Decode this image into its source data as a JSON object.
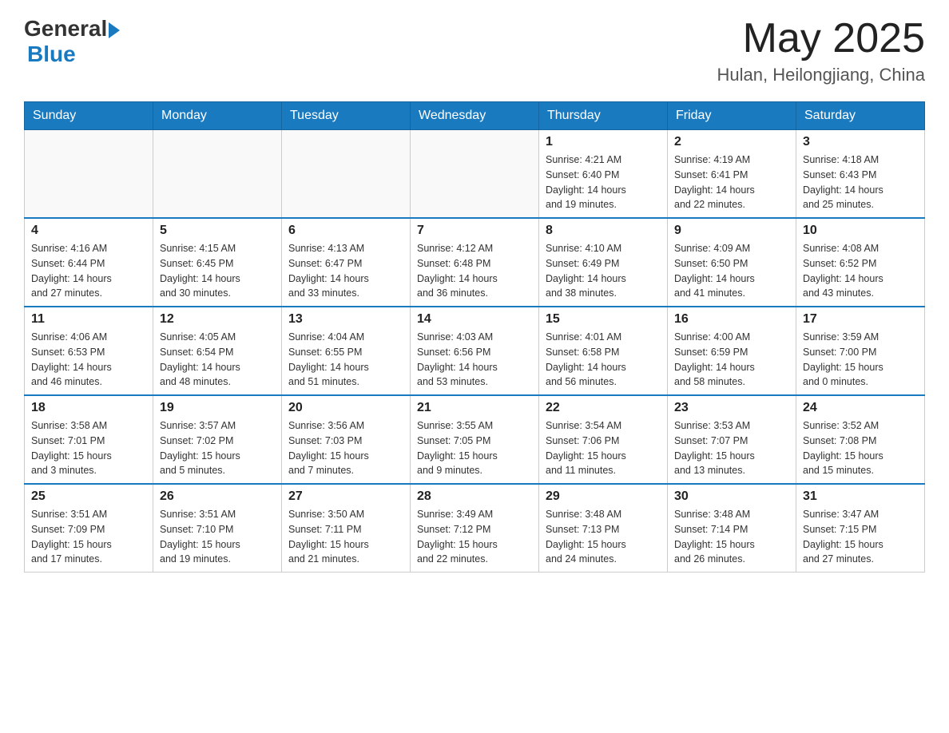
{
  "header": {
    "logo": {
      "general_text": "General",
      "blue_text": "Blue"
    },
    "month_year": "May 2025",
    "location": "Hulan, Heilongjiang, China"
  },
  "days_of_week": [
    "Sunday",
    "Monday",
    "Tuesday",
    "Wednesday",
    "Thursday",
    "Friday",
    "Saturday"
  ],
  "weeks": [
    [
      {
        "day": "",
        "info": ""
      },
      {
        "day": "",
        "info": ""
      },
      {
        "day": "",
        "info": ""
      },
      {
        "day": "",
        "info": ""
      },
      {
        "day": "1",
        "info": "Sunrise: 4:21 AM\nSunset: 6:40 PM\nDaylight: 14 hours\nand 19 minutes."
      },
      {
        "day": "2",
        "info": "Sunrise: 4:19 AM\nSunset: 6:41 PM\nDaylight: 14 hours\nand 22 minutes."
      },
      {
        "day": "3",
        "info": "Sunrise: 4:18 AM\nSunset: 6:43 PM\nDaylight: 14 hours\nand 25 minutes."
      }
    ],
    [
      {
        "day": "4",
        "info": "Sunrise: 4:16 AM\nSunset: 6:44 PM\nDaylight: 14 hours\nand 27 minutes."
      },
      {
        "day": "5",
        "info": "Sunrise: 4:15 AM\nSunset: 6:45 PM\nDaylight: 14 hours\nand 30 minutes."
      },
      {
        "day": "6",
        "info": "Sunrise: 4:13 AM\nSunset: 6:47 PM\nDaylight: 14 hours\nand 33 minutes."
      },
      {
        "day": "7",
        "info": "Sunrise: 4:12 AM\nSunset: 6:48 PM\nDaylight: 14 hours\nand 36 minutes."
      },
      {
        "day": "8",
        "info": "Sunrise: 4:10 AM\nSunset: 6:49 PM\nDaylight: 14 hours\nand 38 minutes."
      },
      {
        "day": "9",
        "info": "Sunrise: 4:09 AM\nSunset: 6:50 PM\nDaylight: 14 hours\nand 41 minutes."
      },
      {
        "day": "10",
        "info": "Sunrise: 4:08 AM\nSunset: 6:52 PM\nDaylight: 14 hours\nand 43 minutes."
      }
    ],
    [
      {
        "day": "11",
        "info": "Sunrise: 4:06 AM\nSunset: 6:53 PM\nDaylight: 14 hours\nand 46 minutes."
      },
      {
        "day": "12",
        "info": "Sunrise: 4:05 AM\nSunset: 6:54 PM\nDaylight: 14 hours\nand 48 minutes."
      },
      {
        "day": "13",
        "info": "Sunrise: 4:04 AM\nSunset: 6:55 PM\nDaylight: 14 hours\nand 51 minutes."
      },
      {
        "day": "14",
        "info": "Sunrise: 4:03 AM\nSunset: 6:56 PM\nDaylight: 14 hours\nand 53 minutes."
      },
      {
        "day": "15",
        "info": "Sunrise: 4:01 AM\nSunset: 6:58 PM\nDaylight: 14 hours\nand 56 minutes."
      },
      {
        "day": "16",
        "info": "Sunrise: 4:00 AM\nSunset: 6:59 PM\nDaylight: 14 hours\nand 58 minutes."
      },
      {
        "day": "17",
        "info": "Sunrise: 3:59 AM\nSunset: 7:00 PM\nDaylight: 15 hours\nand 0 minutes."
      }
    ],
    [
      {
        "day": "18",
        "info": "Sunrise: 3:58 AM\nSunset: 7:01 PM\nDaylight: 15 hours\nand 3 minutes."
      },
      {
        "day": "19",
        "info": "Sunrise: 3:57 AM\nSunset: 7:02 PM\nDaylight: 15 hours\nand 5 minutes."
      },
      {
        "day": "20",
        "info": "Sunrise: 3:56 AM\nSunset: 7:03 PM\nDaylight: 15 hours\nand 7 minutes."
      },
      {
        "day": "21",
        "info": "Sunrise: 3:55 AM\nSunset: 7:05 PM\nDaylight: 15 hours\nand 9 minutes."
      },
      {
        "day": "22",
        "info": "Sunrise: 3:54 AM\nSunset: 7:06 PM\nDaylight: 15 hours\nand 11 minutes."
      },
      {
        "day": "23",
        "info": "Sunrise: 3:53 AM\nSunset: 7:07 PM\nDaylight: 15 hours\nand 13 minutes."
      },
      {
        "day": "24",
        "info": "Sunrise: 3:52 AM\nSunset: 7:08 PM\nDaylight: 15 hours\nand 15 minutes."
      }
    ],
    [
      {
        "day": "25",
        "info": "Sunrise: 3:51 AM\nSunset: 7:09 PM\nDaylight: 15 hours\nand 17 minutes."
      },
      {
        "day": "26",
        "info": "Sunrise: 3:51 AM\nSunset: 7:10 PM\nDaylight: 15 hours\nand 19 minutes."
      },
      {
        "day": "27",
        "info": "Sunrise: 3:50 AM\nSunset: 7:11 PM\nDaylight: 15 hours\nand 21 minutes."
      },
      {
        "day": "28",
        "info": "Sunrise: 3:49 AM\nSunset: 7:12 PM\nDaylight: 15 hours\nand 22 minutes."
      },
      {
        "day": "29",
        "info": "Sunrise: 3:48 AM\nSunset: 7:13 PM\nDaylight: 15 hours\nand 24 minutes."
      },
      {
        "day": "30",
        "info": "Sunrise: 3:48 AM\nSunset: 7:14 PM\nDaylight: 15 hours\nand 26 minutes."
      },
      {
        "day": "31",
        "info": "Sunrise: 3:47 AM\nSunset: 7:15 PM\nDaylight: 15 hours\nand 27 minutes."
      }
    ]
  ]
}
